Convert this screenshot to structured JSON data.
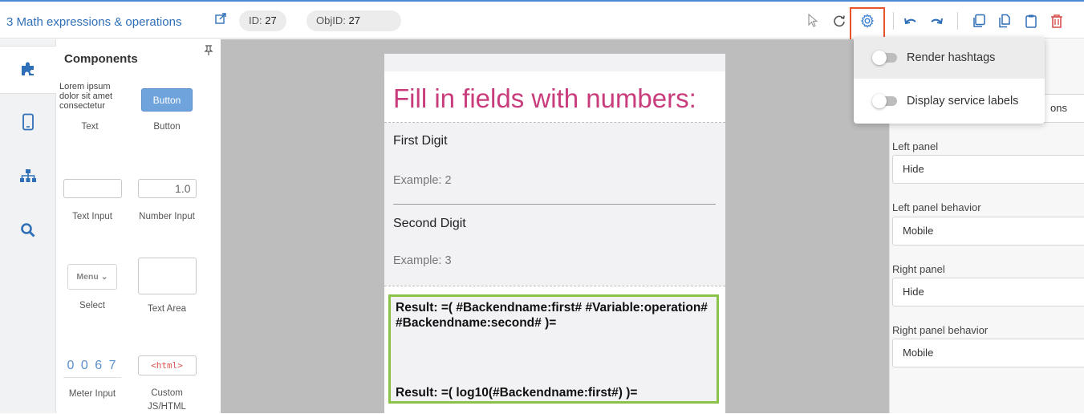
{
  "header": {
    "title": "3 Math expressions & operations",
    "id_label": "ID:",
    "id_value": "27",
    "objid_label": "ObjID:",
    "objid_value": "27",
    "icons": [
      "external-link-icon",
      "cursor-icon",
      "refresh-icon",
      "gear-icon",
      "undo-icon",
      "redo-icon",
      "copy-icon",
      "duplicate-icon",
      "clipboard-icon",
      "trash-icon"
    ],
    "accent": "#4a8ad4",
    "danger": "#d9534f"
  },
  "leftnav": {
    "items": [
      "puzzle-icon",
      "mobile-icon",
      "sitemap-icon",
      "search-icon"
    ]
  },
  "components": {
    "title": "Components",
    "items": [
      {
        "name": "text",
        "label": "Text",
        "preview": "Lorem ipsum dolor sit amet consectetur"
      },
      {
        "name": "button",
        "label": "Button",
        "preview": "Button"
      },
      {
        "name": "text-input",
        "label": "Text Input",
        "preview": ""
      },
      {
        "name": "number-input",
        "label": "Number Input",
        "preview": "1.0"
      },
      {
        "name": "select",
        "label": "Select",
        "preview": "Menu"
      },
      {
        "name": "text-area",
        "label": "Text Area",
        "preview": ""
      },
      {
        "name": "meter-input",
        "label": "Meter Input",
        "preview": "0 0 6 7"
      },
      {
        "name": "custom-js-html",
        "label": "Custom JS/HTML",
        "preview": "<html>"
      }
    ]
  },
  "canvas": {
    "heading": "Fill in fields with numbers:",
    "field1_label": "First Digit",
    "field1_placeholder": "Example: 2",
    "field2_label": "Second Digit",
    "field2_placeholder": "Example: 3",
    "result1": "Result: =( #Backendname:first# #Variable:operation# #Backendname:second# )=",
    "result2": "Result: =( log10(#Backendname:first#) )=",
    "heading_color": "#c93c7c",
    "highlight_color": "#8bc34a"
  },
  "settings_menu": {
    "items": [
      {
        "label": "Render hashtags",
        "enabled": false
      },
      {
        "label": "Display service labels",
        "enabled": false
      }
    ]
  },
  "right_panel": {
    "partial_value": "ons",
    "left_panel_label": "Left panel",
    "left_panel_value": "Hide",
    "left_behavior_label": "Left panel behavior",
    "left_behavior_value": "Mobile",
    "right_panel_label": "Right panel",
    "right_panel_value": "Hide",
    "right_behavior_label": "Right panel behavior",
    "right_behavior_value": "Mobile"
  }
}
